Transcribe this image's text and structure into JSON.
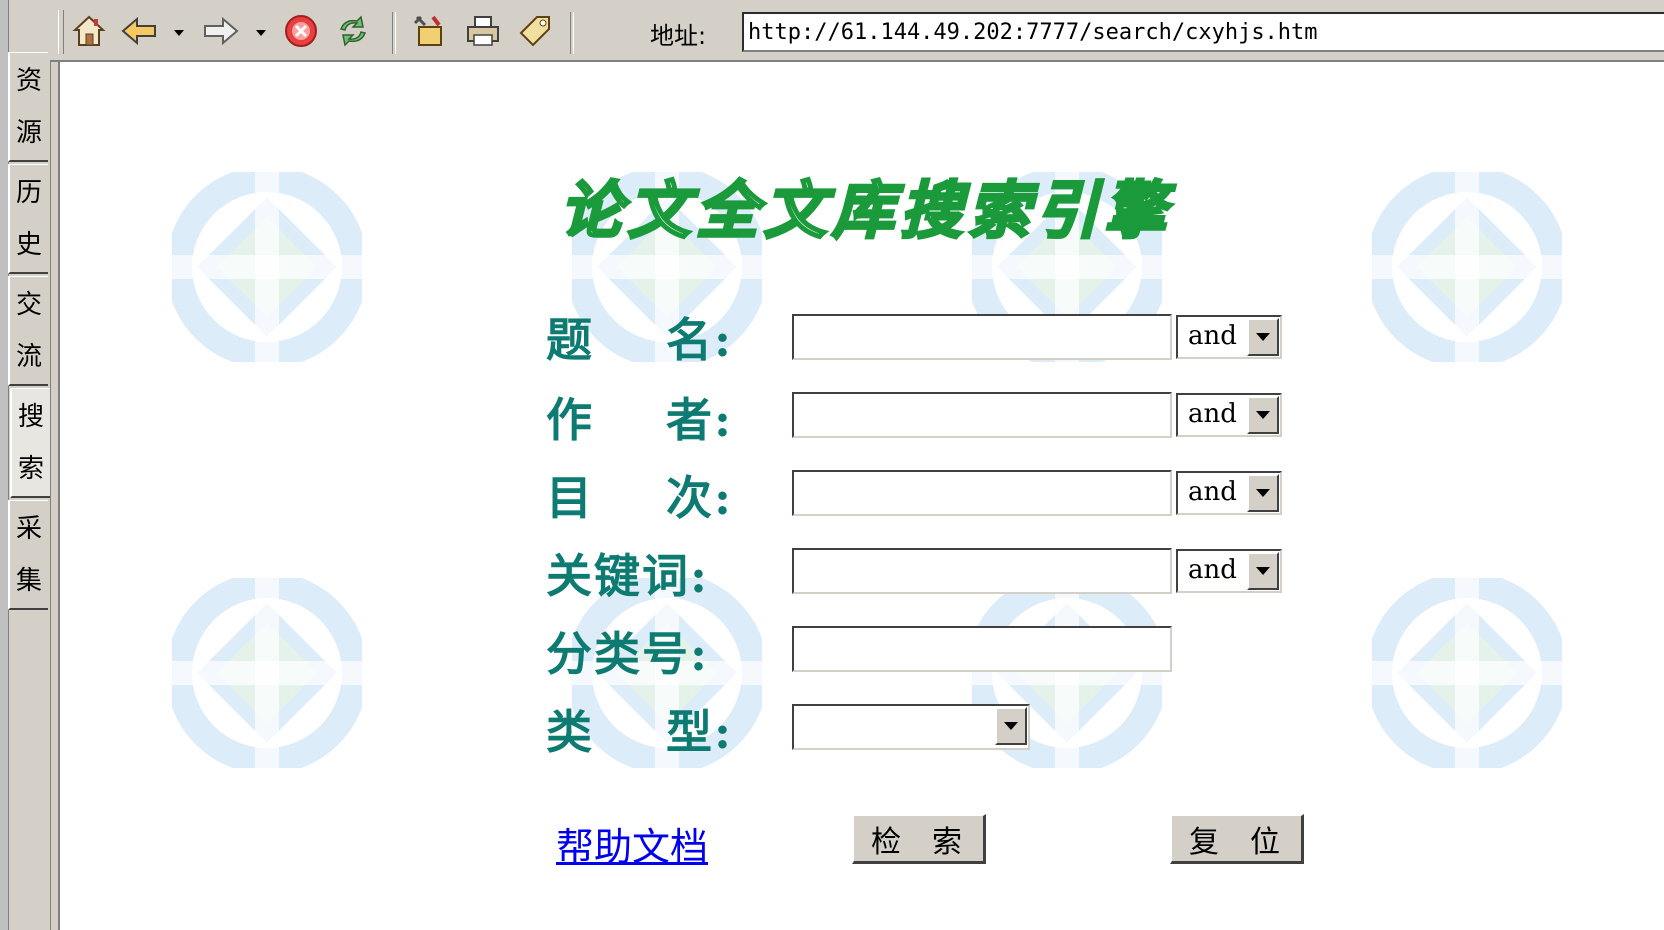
{
  "sidebar": {
    "tabs": [
      {
        "label_1": "资",
        "label_2": "源"
      },
      {
        "label_1": "历",
        "label_2": "史"
      },
      {
        "label_1": "交",
        "label_2": "流"
      },
      {
        "label_1": "搜",
        "label_2": "索"
      },
      {
        "label_1": "采",
        "label_2": "集"
      }
    ],
    "active_tab_index": 3
  },
  "toolbar": {
    "icons": [
      "home-icon",
      "back-icon",
      "forward-icon",
      "stop-icon",
      "refresh-icon",
      "tools-icon",
      "print-icon",
      "tag-icon"
    ],
    "address_label": "地址:",
    "address_value": "http://61.144.49.202:7777/search/cxyhjs.htm"
  },
  "form": {
    "title": "论文全文库搜索引擎",
    "fields": [
      {
        "label": "题    名:",
        "value": "",
        "op": "and"
      },
      {
        "label": "作    者:",
        "value": "",
        "op": "and"
      },
      {
        "label": "目    次:",
        "value": "",
        "op": "and"
      },
      {
        "label": "关键词:",
        "value": "",
        "op": "and"
      },
      {
        "label": "分类号:",
        "value": ""
      },
      {
        "label": "类    型:",
        "value": ""
      }
    ],
    "help_link": "帮助文档",
    "search_button": "检  索",
    "reset_button": "复  位"
  },
  "colors": {
    "title_stroke": "#1a9a3a",
    "label_color": "#0e7b72",
    "watermark": "#dcecf8",
    "chrome": "#d4d0c8"
  }
}
